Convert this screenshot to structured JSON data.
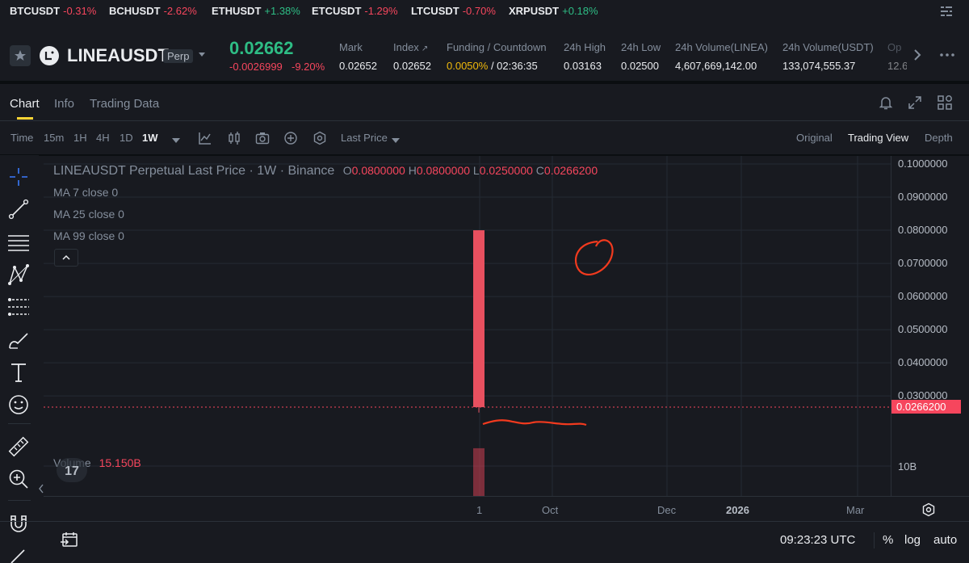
{
  "ticker": [
    {
      "symbol": "BTCUSDT",
      "change": "-0.31%",
      "dir": "down"
    },
    {
      "symbol": "BCHUSDT",
      "change": "-2.62%",
      "dir": "down"
    },
    {
      "symbol": "ETHUSDT",
      "change": "+1.38%",
      "dir": "up"
    },
    {
      "symbol": "ETCUSDT",
      "change": "-1.29%",
      "dir": "down"
    },
    {
      "symbol": "LTCUSDT",
      "change": "-0.70%",
      "dir": "down"
    },
    {
      "symbol": "XRPUSDT",
      "change": "+0.18%",
      "dir": "up"
    }
  ],
  "header": {
    "symbol": "LINEAUSDT",
    "contract_type": "Perp",
    "last_price": "0.02662",
    "change_abs": "-0.0026999",
    "change_pct": "-9.20%",
    "stats": [
      {
        "label": "Mark",
        "value": "0.02652"
      },
      {
        "label": "Index",
        "value": "0.02652"
      },
      {
        "label": "Funding / Countdown",
        "value_rate": "0.0050%",
        "value_time": " / 02:36:35"
      },
      {
        "label": "24h High",
        "value": "0.03163"
      },
      {
        "label": "24h Low",
        "value": "0.02500"
      },
      {
        "label": "24h Volume(LINEA)",
        "value": "4,607,669,142.00"
      },
      {
        "label": "24h Volume(USDT)",
        "value": "133,074,555.37"
      },
      {
        "label": "Op",
        "value": "12.6"
      }
    ]
  },
  "tabs": [
    "Chart",
    "Info",
    "Trading Data"
  ],
  "toolbar": {
    "time_label": "Time",
    "intervals": [
      "15m",
      "1H",
      "4H",
      "1D",
      "1W"
    ],
    "active_interval": "1W",
    "price_type": "Last Price",
    "views": [
      "Original",
      "Trading View",
      "Depth"
    ],
    "active_view": "Trading View"
  },
  "legend": {
    "title": "LINEAUSDT Perpetual Last Price · 1W · Binance",
    "o_label": "O",
    "o": "0.0800000",
    "h_label": "H",
    "h": "0.0800000",
    "l_label": "L",
    "l": "0.0250000",
    "c_label": "C",
    "c": "0.0266200",
    "ma7": "MA 7 close 0",
    "ma25": "MA 25 close 0",
    "ma99": "MA 99 close 0",
    "volume_label": "Volume",
    "volume_value": "15.150B"
  },
  "chart_data": {
    "type": "candlestick",
    "interval": "1W",
    "candles": [
      {
        "x": "1",
        "open": 0.08,
        "high": 0.08,
        "low": 0.025,
        "close": 0.02662,
        "volume_b": 15.15
      }
    ],
    "price_ticks": [
      "0.1000000",
      "0.0900000",
      "0.0800000",
      "0.0700000",
      "0.0600000",
      "0.0500000",
      "0.0400000",
      "0.0300000"
    ],
    "price_ticks_values": [
      0.1,
      0.09,
      0.08,
      0.07,
      0.06,
      0.05,
      0.04,
      0.03
    ],
    "last_price_label": "0.0266200",
    "last_price": 0.02662,
    "volume_tick": "10B",
    "x_labels": [
      "1",
      "Oct",
      "Dec",
      "2026",
      "Mar"
    ],
    "ylim": [
      0.022,
      0.1
    ]
  },
  "bottom": {
    "time": "09:23:23 UTC",
    "pct": "%",
    "log": "log",
    "auto": "auto"
  },
  "colors": {
    "down": "#f6465d",
    "up": "#2ebd85",
    "accent": "#fcd535"
  }
}
